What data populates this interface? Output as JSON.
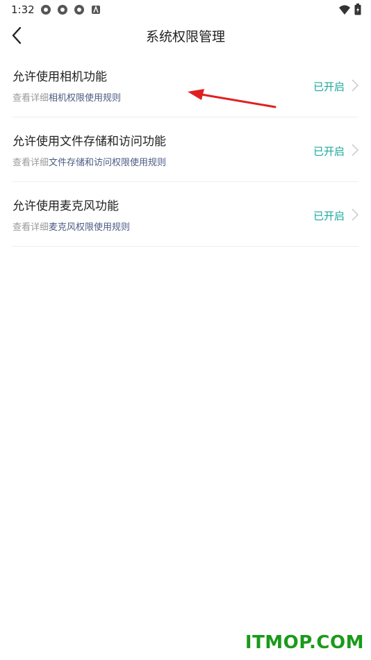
{
  "status": {
    "time": "1:32"
  },
  "header": {
    "title": "系统权限管理"
  },
  "rows": [
    {
      "title": "允许使用相机功能",
      "sub_prefix": "查看详细",
      "sub_link": "相机权限使用规则",
      "status": "已开启"
    },
    {
      "title": "允许使用文件存储和访问功能",
      "sub_prefix": "查看详细",
      "sub_link": "文件存储和访问权限使用规则",
      "status": "已开启"
    },
    {
      "title": "允许使用麦克风功能",
      "sub_prefix": "查看详细",
      "sub_link": "麦克风权限使用规则",
      "status": "已开启"
    }
  ],
  "watermark": "ITMOP.COM",
  "colors": {
    "accent": "#1aa89a",
    "link": "#4a5a80",
    "annotation": "#e02020",
    "watermark": "#1a9a1a"
  },
  "icons": {
    "status_bar": [
      "settings-icon",
      "settings-icon",
      "settings-icon",
      "app-icon",
      "wifi-icon",
      "battery-icon"
    ],
    "header": "back-chevron-icon",
    "row": "chevron-right-icon"
  }
}
